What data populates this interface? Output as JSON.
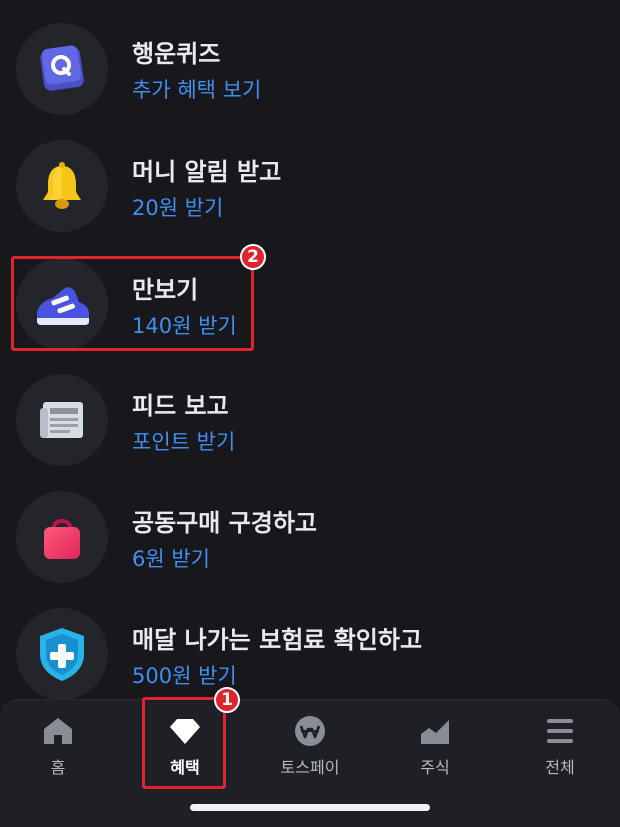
{
  "items": [
    {
      "title": "행운퀴즈",
      "sub": "추가 혜택 보기",
      "icon": "quiz-q-icon"
    },
    {
      "title": "머니 알림 받고",
      "sub": "20원 받기",
      "icon": "bell-icon"
    },
    {
      "title": "만보기",
      "sub": "140원 받기",
      "icon": "sneaker-icon"
    },
    {
      "title": "피드 보고",
      "sub": "포인트 받기",
      "icon": "newspaper-icon"
    },
    {
      "title": "공동구매 구경하고",
      "sub": "6원 받기",
      "icon": "shopping-bag-icon"
    },
    {
      "title": "매달 나가는 보험료 확인하고",
      "sub": "500원 받기",
      "icon": "shield-plus-icon"
    }
  ],
  "tabs": [
    {
      "label": "홈",
      "icon": "home-icon"
    },
    {
      "label": "혜택",
      "icon": "diamond-icon",
      "active": true
    },
    {
      "label": "토스페이",
      "icon": "won-coin-icon"
    },
    {
      "label": "주식",
      "icon": "chart-icon"
    },
    {
      "label": "전체",
      "icon": "menu-icon"
    }
  ],
  "annotations": {
    "badge1": "1",
    "badge2": "2"
  },
  "colors": {
    "background": "#17171c",
    "accent_blue": "#3f8ff0",
    "highlight_red": "#e0242e"
  }
}
